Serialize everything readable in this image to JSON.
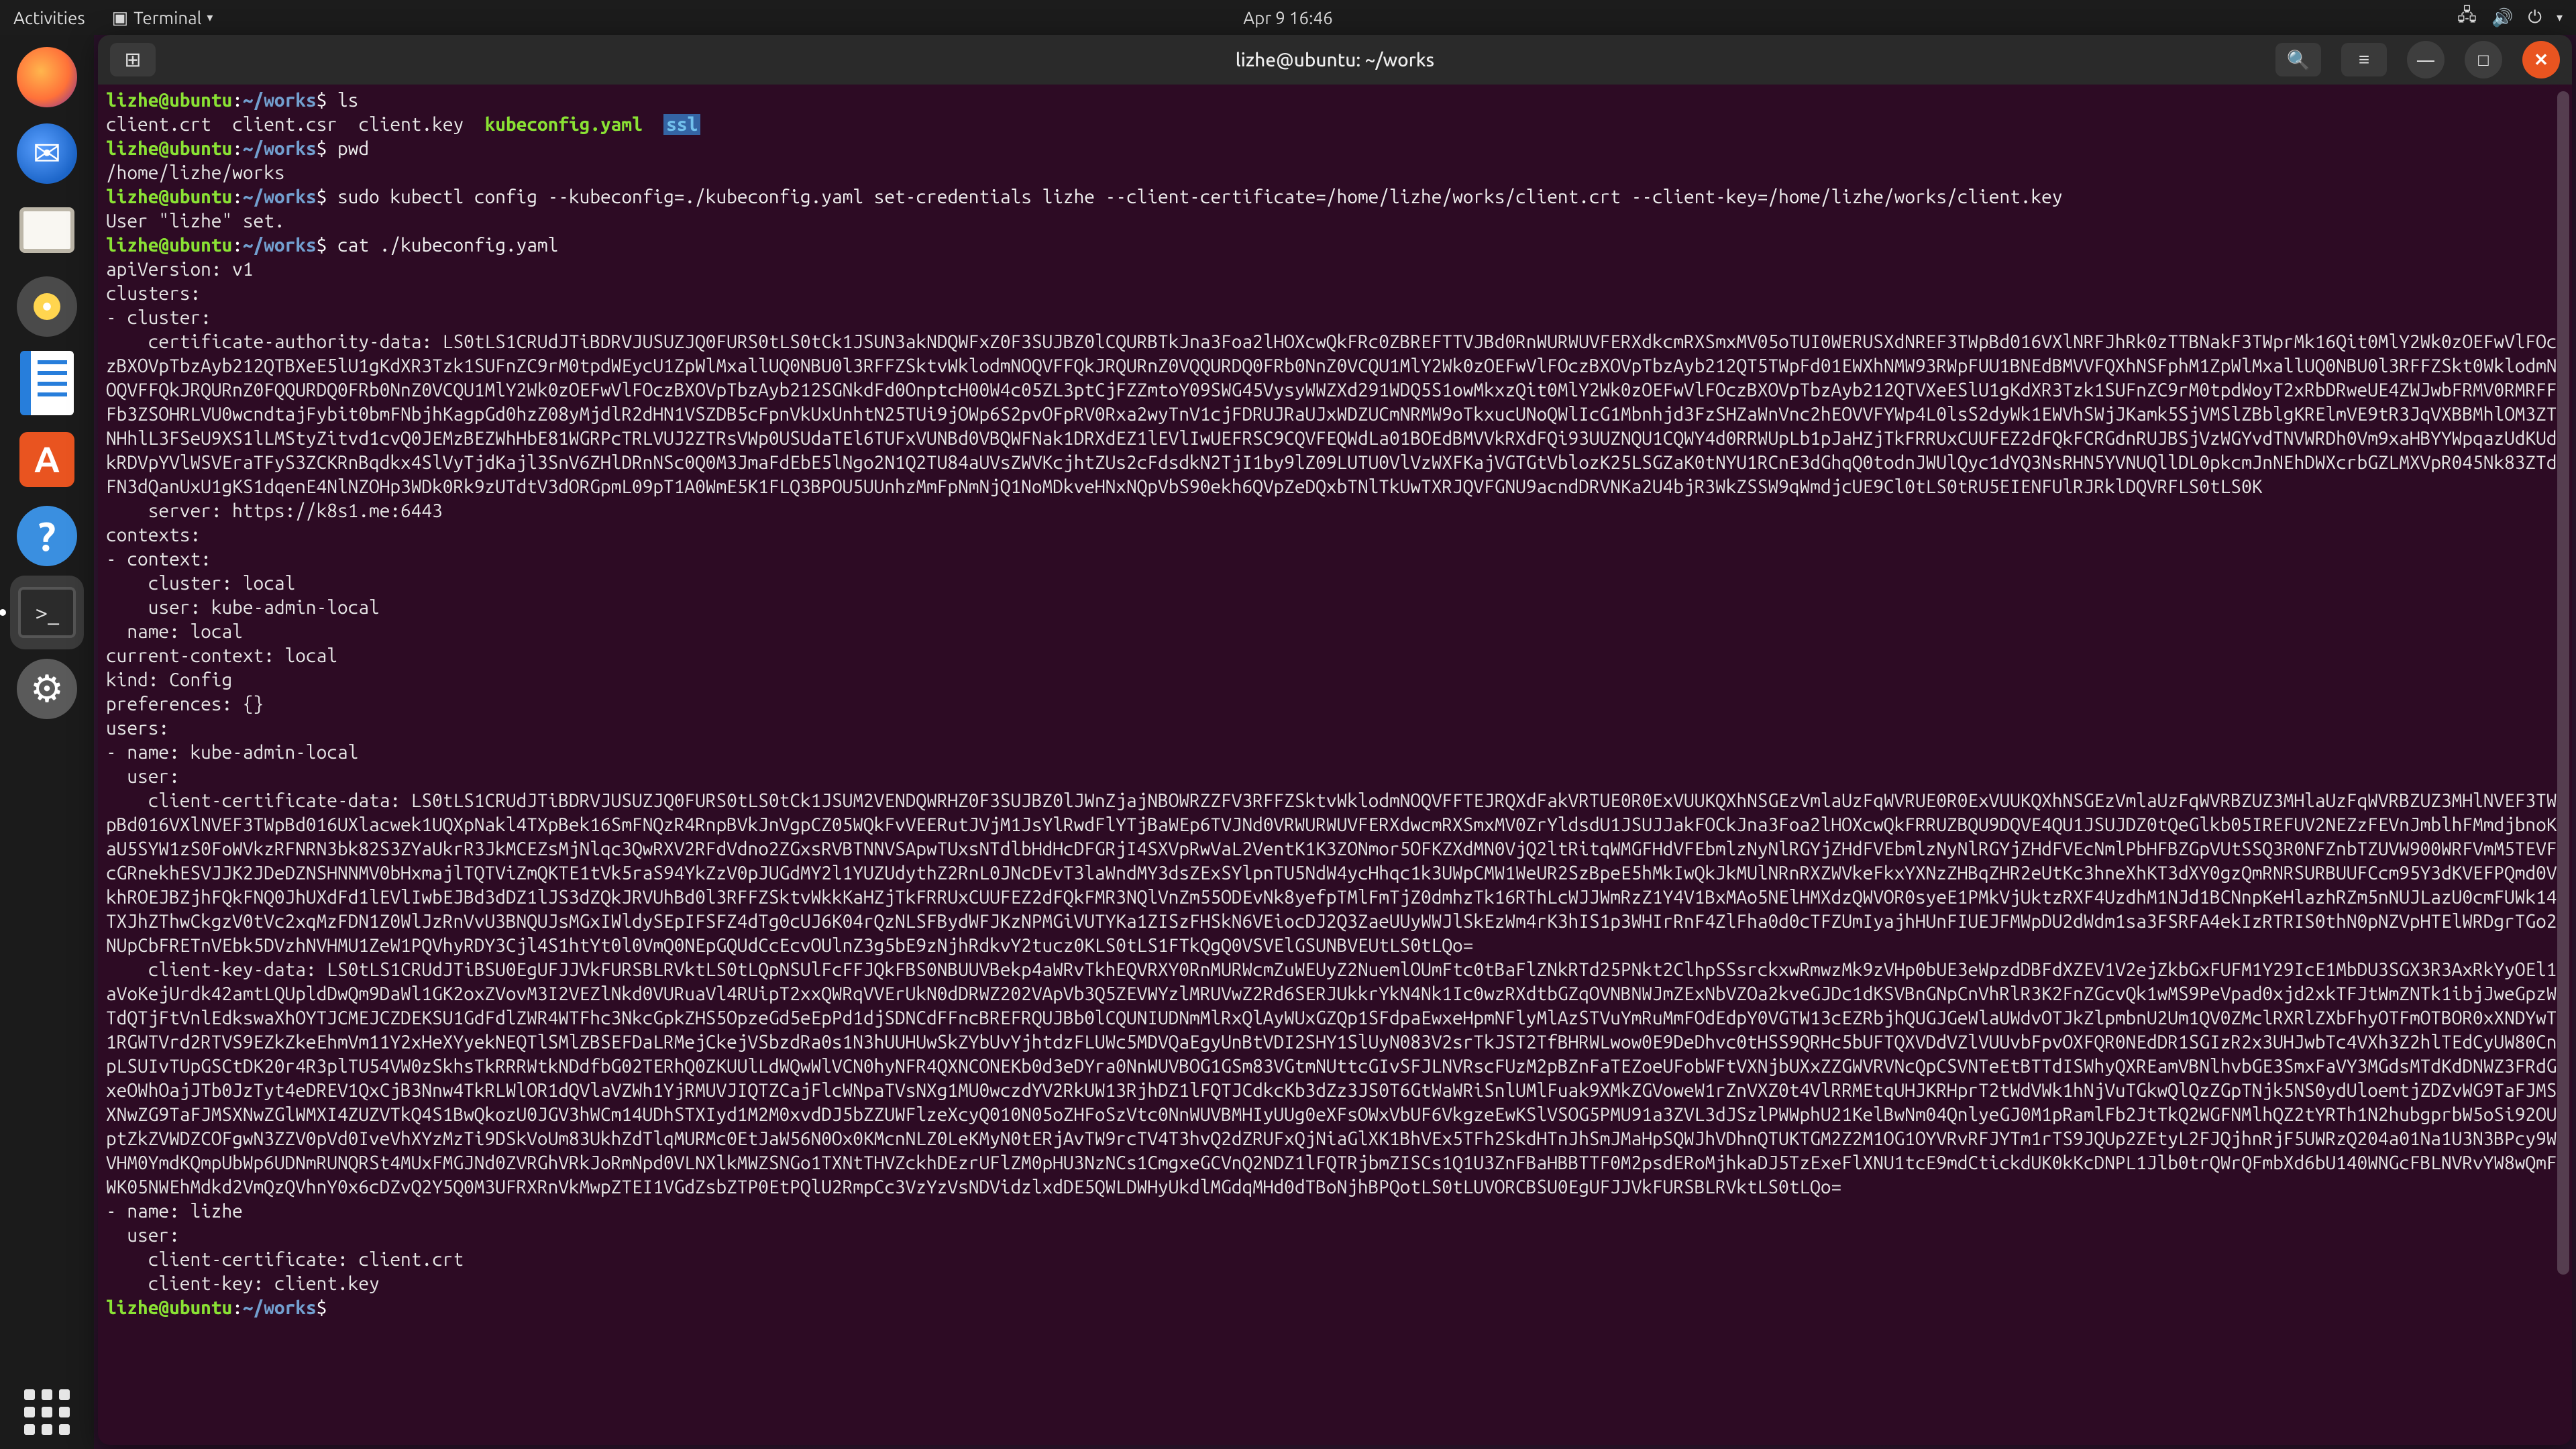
{
  "topbar": {
    "activities": "Activities",
    "app_menu": "Terminal",
    "clock": "Apr 9  16:46"
  },
  "dock": {
    "items": [
      {
        "name": "firefox"
      },
      {
        "name": "thunderbird"
      },
      {
        "name": "files"
      },
      {
        "name": "rhythmbox"
      },
      {
        "name": "libreoffice-writer"
      },
      {
        "name": "software"
      },
      {
        "name": "help"
      },
      {
        "name": "terminal"
      },
      {
        "name": "settings"
      }
    ]
  },
  "window": {
    "title": "lizhe@ubuntu: ~/works",
    "newtab_icon": "⊞"
  },
  "prompt": {
    "user_host": "lizhe@ubuntu",
    "sep": ":",
    "path": "~/works",
    "sym": "$"
  },
  "cmd": {
    "ls": "ls",
    "pwd": "pwd",
    "setcred": "sudo kubectl config --kubeconfig=./kubeconfig.yaml set-credentials lizhe --client-certificate=/home/lizhe/works/client.crt --client-key=/home/lizhe/works/client.key",
    "cat": "cat ./kubeconfig.yaml"
  },
  "out": {
    "ls_items": {
      "a": "client.crt",
      "b": "client.csr",
      "c": "client.key",
      "d": "kubeconfig.yaml",
      "e": "ssl"
    },
    "pwd": "/home/lizhe/works",
    "setcred": "User \"lizhe\" set.",
    "yaml_head": "apiVersion: v1\nclusters:\n- cluster:",
    "cert_auth_label": "    certificate-authority-data: ",
    "cert_auth_data": "LS0tLS1CRUdJTiBDRVJUSUZJQ0FURS0tLS0tCk1JSUN3akNDQWFxZ0F3SUJBZ0lCQURBTkJna3Foa2lHOXcwQkFRc0ZBREFTTVJBd0RnWURWUVFERXdkcmRXSmxMV05oTUI0WERUSXdNREF3TWpBd016VXlNRFJhRk0zTTBNakF3TWprMk16Qit0MlY2Wk0zOEFwVlFOczBXOVpTbzAyb212QTBXeE5lU1gKdXR3Tzk1SUFnZC9rM0tpdWEycU1ZpWlMxallUQ0NBU0l3RFFZSktvWklodmNOQVFFQkJRQURnZ0VQQURDQ0FRb0NnZ0VCQU1MlY2Wk0zOEFwVlFOczBXOVpTbzAyb212QT",
    "cert_auth_data2": "5TWpFd01EWXhNMW93RWpFUU1BNEdBMVVFQXhNSFphM1ZpWlMxallUQ0NBU0l3RFFZSkt0WklodmNOQVFFQkJRQURnZ0FQQURDQ0FRb0NnZ0VCQU1MlY2Wk0zOEFwVlFOczBXOVpTbzAyb212SGNkdFd0OnptcH00W4c05ZL3ptCjFZZmtoY09SWG45VysyWWZXd291WDQ5S1owMkxzQit0MlY2Wk0zOEFwVlFOczBXOVpTbzAyb212QT",
    "cert_auth_data3": "VXeESlU1gKdXR3Tzk1SUFnZC9rM0tpdWoyT2xRbDRweUE4ZWJwbFRMV0RMRFFFb3ZSOHRLVU0wcndtajFybit0bmFNbjhKagpGd0hzZ08yMjdlR2dHN1VSZDB5cFpnVkUxUnhtN25TUi9jOWp6S2pvOFpRV0Rxa2wyTnV1cjFDRUJRaUJxWDZUCmNRMW9oTkxucUNoQWlIc",
    "cert_auth_data4": "G1Mbnhjd3FzSHZaWnVnc2hEOVVFYWp4L0lsS2dyWk1EWVhSWjJKamk5SjVMSlZBblgKRElmVE9tR3JqVXBBMhlOM3ZTNHhlL3FSeU9XS1lLMStyZitvd1cvQ0JEMzBEZWhHbE81WGRPcTRLVUJ2ZTRsVWp0USUdaTEl6TUFxVUNBd0VBQWFNak1DRXdEZ1lEVlIwUEFRSC9C",
    "cert_auth_data5": "QVFEQWdLa01BOEdBMVVkRXdFQi93UUZNQU1CQWY4d0RRWUpLb1pJaHZjTkFRRUxCUUFEZ2dFQkFCRGdnRUJBSjVzWGYvdTNVWRDh0Vm9xaHBYYWpqazUdKUdkRDVpYVlWSVEraTFyS3ZCKRnBqdkx4SlVyTjdKajl3SnV6ZHlDRnNSc0Q0M3JmaFd",
    "cert_auth_data6": "EbE5lNgo2N1Q2TU84aUVsZWVKcjhtZUs2cFdsdkN2TjI1by9lZ09LUTU0VlVzWXFKajVGTGtVblozK25LSGZaK0tNYU1RCnE3dGhqQ0todnJWUlQyc1dYQ3NsRHN5YVNUQllDL0pkcmJnNEhDWXcrbGZLMXVpR045Nk83ZTdFN3dQanUxU1gKS1dqenE4NlNZOHp3WDk0Rk",
    "cert_auth_data7": "9zUTdtV3dORGpmL09pT1A0WmE5K1FLQ3BPOU5UUnhzMmFpNmNjQ1NoMDkveHNxNQpVbS90ekh6QVpZeDQxbTNlTkUwTXRJQVFGNU9acndDRVNKa2U4bjR3WkZSSW9qWmdjcUE9Cl0tLS0tRU5EIENFUlRJRklDQVRFLS0tLS0K",
    "server_line": "    server: https://k8s1.me:6443",
    "contexts_block": "contexts:\n- context:\n    cluster: local\n    user: kube-admin-local\n  name: local\ncurrent-context: local\nkind: Config\npreferences: {}\nusers:\n- name: kube-admin-local\n  user:",
    "client_cert_label": "    client-certificate-data: ",
    "client_cert_data": "LS0tLS1CRUdJTiBDRVJUSUZJQ0FURS0tLS0tCk1JSUM2VENDQWRHZ0F3SUJBZ0lJWnZjajNBOWRZZFV3RFFZSktvWklodmNOQVFFTEJRQXdFakVRTUE0R0ExVUUKQXhNSGEzVmlaUzFqWVRUE0R0ExVUUKQXhNSGEzVmlaUzFqWVRBZUZ3MHlaUzFqWVRBZUZ3MHlNVEF3TWpBd016VXlNVEF3TWpBd016UXla",
    "client_cert_data2": "cwek1UQXpNakl4TXpBek16SmFNQzR4RnpBVkJnVgpCZ05WQkFvVEERutJVjM1JsYlRwdFlYTjBaWEp6TVJNd0VRWURWUVFERXdwcmRXSmxMV0ZrYldsdU1JSUJJakFOCkJna3Foa2lHOXcwQkFRRUZBQU9DQVE4QU1JSUJDZ0tQeGlkb05IREFUV2NEZzFEVnJmblhFM",
    "client_cert_data3": "mdjbnoKaU5SYW1zS0FoWVkzRFNRN3bk82S3ZYaUkrR3JkMCEZsMjNlqc3QwRXV2RFdVdno2ZGxsRVBTNNVSApwTUxsNTdlbHdHcDFGRjI4SXVpRwVaL2VentK1K3ZONmor5OFKZXdMN0VjQ2ltRitqWMGFHdVFEbmlzNyNlRGYjZHdFVEbmlzNyNlRGYjZHdFVEcNmlPbHFBZGpVUtSSQ3R0NFZn",
    "client_cert_data4": "bTZUVW900WRFVmM5TEVFcGRnekhESVJJK2JDeDZNSHNNMV0bHxmajlTQTViZmQKTE1tVk5raS94YkZzV0pJUGdMY2l1YUZUdythZ2RnL0JNcDEvT3laWndMY3dsZExSYlpnTU5NdW4ycHhqc1k3UWpCMW1WeUR2SzBpeE5hMkIwQkJkMUlNRnRXZWVkeFkxYXNzZHBqZHR",
    "client_cert_data5": "2eUtKc3hneXhKT3dXY0gzQmRNRSURBUUFCcm95Y3dKVEFPQmd0VkhROEJBZjhFQkFNQ0JhUXdFd1lEVlIwbEJBd3dDZ1lJS3dZQkJRVUhBd0l3RFFZSktvWkkKaHZjTkFRRUxCUUFEZ2dFQkFMR3NQlVnZm55ODEvNk8yefpTMlFmTjZ0dmhzTk16RThLcWJJWmRzZ1Y4V1",
    "client_cert_data6": "BxMAo5NElHMXdzQWVOR0syeE1PMkVjUktzRXF4UzdhM1NJd1BCNnpKeHlazhRZm5nNUJLazU0cmFUWk14TXJhZThwCkgzV0tVc2xqMzFDN1Z0WlJzRnVvU3BNQUJsMGxIWldySEpIFSFZ4dTg0cUJ6K04rQzNLSFBydWFJKzNPMGiVUTYKa1ZISzFHSkN6VEiocDJ2Q3Zae",
    "client_cert_data7": "UUyWWJlSkEzWm4rK3hIS1p3WHIrRnF4ZlFha0d0cTFZUmIyajhHUnFIUEJFMWpDU2dWdm1sa3FSRFA4ekIzRTRIS0thN0pNZVpHTElWRDgrTGo2NUpCbFRETnVEbk5DVzhNVHMU1ZeW1PQVhyRDY3Cjl4S1htYt0l0VmQ0NEpGQUdCcEcvOUlnZ3g5bE9zNjhRdkvY2tucz0K",
    "client_cert_data8": "LS0tLS1FTkQgQ0VSVElGSUNBVEUtLS0tLQo=",
    "client_key_label": "    client-key-data: ",
    "client_key_data": "LS0tLS1CRUdJTiBSU0EgUFJJVkFURSBLRVktLS0tLQpNSUlFcFFJQkFBS0NBUUVBekp4aWRvTkhEQVRXY0RnMURWcmZuWEUyZ2NuemlOUmFtc0tBaFlZNkRTd25PNkt2ClhpSSsrckxwRmwzMk9zVHp0bUE3eWpzdDBFdXZEV1V2ejZkbGxFUF",
    "client_key_data2": "M1Y29IcE1MbDU3SGX3R3AxRkYyOEl1aVoKejUrdk42amtLQUpldDwQm9DaWl1GK2oxZVovM3I2VEZlNkd0VURuaVl4RUipT2xxQWRqVVErUkN0dDRWZ202VApVb3Q5ZEVWYzlMRUVwZ2Rd6SERJUkkrYkN4Nk1Ic0wzRXdtbGZqOVNBNWJmZExNbVZOa2kveGJDc1dKSVBn",
    "client_key_data3": "GNpCnVhRlR3K2FnZGcvQk1wMS9PeVpad0xjd2xkTFJtWmZNTk1ibjJweGpzWTdQTjFtVnlEdkswaXhOYTJCMEJCZDEKSU1GdFdlZWR4WTFhc3NkcGpkZHS5OpzeGd5eEpPd1djSDNCdFFncBREFRQUJBb0lCQUNIUDNmMlRxQlAyWUxGZQp1SFdpaEwxeHpmNFlyMlAzSTVu",
    "client_key_data4": "YmRuMmFOdEdpY0VGTW13cEZRbjhQUGJGeWlaUWdvOTJkZlpmbnU2Um1QV0ZMclRXRlZXbFhyOTFmOTBOR0xXNDYwT1RGWTVrd2RTVS9EZkZkeEhmVm11Y2xHeXYyekNEQTlSMlZBSEFDaLRMejCkejVSbzdRa0s1N3hUUHUwSkZYbUvYjhtdzFLUWc5MDVQaEgyUnBtVDI",
    "client_key_data5": "2SHY1SlUyN083V2srTkJST2TfBHRWLwow0E9DeDhvc0tHSS9QRHc5bUFTQXVDdVZlVUUvbFpvOXFQR0NEdDR1SGIzR2x3UHJwbTc4VXh3Z2hlTEdCyUW80CnpLSUIvTUpGSCtDK20r4R3plTU54VW0zSkhsTkRRRWtkNDdfbG02TERhQ0ZKUUlLdWQwWlVCN0hyNFR4QXNCON",
    "client_key_data6": "EKb0d3eDYra0NnWUVBOG1GSm83VGtmNUttcGIvSFJLNVRscFUzM2pBZnFaTEZoeUFobWFtVXNjbUXxZZGWVRVNcQpCSVNTeEtBTTdISWhyQXREamVBNlhvbGE3SmxFaVY3MGdsMTdKdDNWZ3FRdGxeOWhOajJTb0JzTyt4eDREV1QxCjB3Nnw4TkRLWlOR1dQVlaVZWh1Y",
    "client_key_data7": "jRMUVJIQTZCajFlcWNpaTVsNXg1MU0wczdYV2RkUW13RjhDZ1lFQTJCdkcKb3dZz3JS0T6GtWaWRiSnlUMlFuak9XMkZGVoweW1rZnVXZ0t4VlRRMEtqUHJKRHprT2tWdVWk1hNjVuTGkwQlQzZGpTNjk5NS0ydUloemtjZDZvWG9TaFJMSXNwZG9TaFJMSXNwZGlW",
    "client_key_data8": "MXI4ZUZVTkQ4S1BwQkozU0JGV3hWCm14UDhSTXIyd1M2M0xvdDJ5bZZUWFlzeXcyQ010N05oZHFoSzVtc0NnWUVBMHIyUUg0eXFsOWxVbUF6VkgzeEwKSlVSOG5PMU91a3ZVL3dJSzlPWWphU21KelBwNm04QnlyeGJ0M1pRamlFb2JtTkQ2WGFNMlhQZ2tYRTh1N2hubgp",
    "client_key_data9": "rbW5oSi92OUptZkZVWDZCOFgwN3ZZV0pVd0IveVhXYzMzTi9DSkVoUm83UkhZdTlqMURMc0EtJaW56N0Ox0KMcnNLZ0LeKMyN0tERjAvTW9rcTV4T3hvQ2dZRUFxQjNiaGlXK1BhVEx5TFh2SkdHTnJhSmJMaHpSQWJhVDhnQTUKTGM2Z2M1OG1OYVRvRFJYTm1rTS9JQU",
    "client_key_data10": "p2ZEtyL2FJQjhnRjF5UWRzQ204a01Na1U3N3BPcy9WVHM0YmdKQmpUbWp6UDNmRUNQRSt4MUxFMGJNd0ZVRGhVRkJoRmNpd0VLNXlkMWZSNGo1TXNtTHVZckhDEzrUFlZM0pHU3NzNCs1CmgxeGCVnQ2NDZ1lFQTRjbmZISCs1Q1U3ZnFBaHBBTTF0M2psdERoMjhkaDJ5T",
    "client_key_data11": "zExeFlXNU1tcE9mdCtickdUK0kKcDNPL1Jlb0trQWrQFmbXd6bU140WNGcFBLNVRvYW8wQmFWK05NWEhMdkd2VmQzQVhnY0x6cDZvQ2Y5Q0M3UFRXRnVkMwpZTEI1VGdZsbZTP0EtPQlU2RmpCc3VzYzVsNDVidzlxdDE5QWLDWHyUkdlMGdqMHd0dTBoNjhBPQotLS0tLUVORCBS",
    "client_key_data12": "U0EgUFJJVkFURSBLRVktLS0tLQo=",
    "lizhe_block": "- name: lizhe\n  user:\n    client-certificate: client.crt\n    client-key: client.key"
  }
}
